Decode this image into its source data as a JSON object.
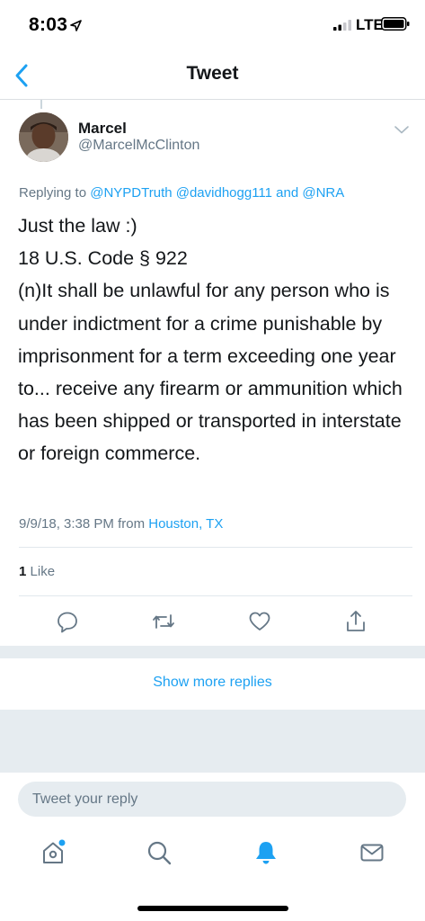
{
  "status_bar": {
    "time": "8:03",
    "network": "LTE"
  },
  "nav": {
    "title": "Tweet"
  },
  "tweet": {
    "author_name": "Marcel",
    "author_handle": "@MarcelMcClinton",
    "replying_prefix": "Replying to",
    "replying_handles": "@NYPDTruth @davidhogg111 and @NRA",
    "body": "Just the law :)\n18 U.S. Code § 922\n(n)It shall be unlawful for any person who is under indictment for a crime punishable by imprisonment for a term exceeding one year to... receive any firearm or ammunition which has been shipped or transported in interstate or foreign commerce.",
    "timestamp": "9/9/18, 3:38 PM",
    "from_label": "from",
    "location": "Houston, TX",
    "like_count": "1",
    "like_label": "Like"
  },
  "actions": {
    "icons": [
      "reply-icon",
      "retweet-icon",
      "like-icon",
      "share-icon"
    ]
  },
  "show_more": "Show more replies",
  "reply": {
    "placeholder": "Tweet your reply"
  },
  "tab_bar": {
    "icons": [
      "home-icon",
      "search-icon",
      "notifications-icon",
      "messages-icon"
    ],
    "active": "notifications-icon"
  },
  "colors": {
    "accent": "#1da1f2",
    "text": "#14171a",
    "secondary": "#657786",
    "divider": "#e1e8ed",
    "gray_bg": "#e6ecf0"
  }
}
